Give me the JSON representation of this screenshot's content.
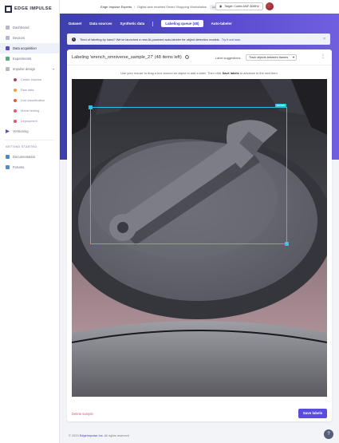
{
  "brand": {
    "name": "EDGE IMPULSE"
  },
  "sidebar": {
    "items": [
      {
        "label": "Dashboard",
        "color": "#8a8ea3"
      },
      {
        "label": "Devices",
        "color": "#8a8ea3"
      },
      {
        "label": "Data acquisition",
        "color": "#5a4bd0"
      },
      {
        "label": "Experiments",
        "color": "#4bb071"
      },
      {
        "label": "Impulse design",
        "color": "#8a8ea3"
      }
    ],
    "impulse_sub": [
      {
        "label": "Create impulse",
        "color": "#a3475b"
      },
      {
        "label": "Raw data",
        "color": "#e6a43a"
      },
      {
        "label": "Live classification",
        "color": "#e05a3a"
      },
      {
        "label": "Model testing",
        "color": "#e05a6b"
      },
      {
        "label": "Deployment",
        "color": "#e0556b"
      }
    ],
    "versioning": {
      "label": "Versioning",
      "color": "#5a4bd0"
    },
    "getting_started_head": "GETTING STARTED",
    "getting_started": [
      {
        "label": "Documentation",
        "color": "#4b8bd0"
      },
      {
        "label": "Forums",
        "color": "#4b8bd0"
      }
    ]
  },
  "topbar": {
    "org": "Edge Impulse Experts",
    "separator": "/",
    "project": "Digital-twin enabled Smart Shopping Workstation",
    "badge": "ENTERPRISE",
    "target": "Target: Cortex-M4F 80MHz"
  },
  "tabs": [
    "Dataset",
    "Data sources",
    "Synthetic data",
    "Labeling queue (48)",
    "Auto-labeler"
  ],
  "active_tab": 3,
  "alert": {
    "text": "Tired of labeling by hand? We've launched a new AI-powered auto-labeler for object detection models.",
    "link": "Try it out now."
  },
  "card": {
    "title": "Labeling 'wrench_omniverse_sample_27' (48 items left)",
    "suggest_label": "Label suggestions:",
    "suggest_value": "Track objects between frames",
    "instruction_pre": "Use your mouse to drag a box around an object to add a label. Then click",
    "instruction_bold": "Save labels",
    "instruction_post": "to advance to the next item."
  },
  "bbox": {
    "label": "wrench"
  },
  "actions": {
    "delete": "Delete sample",
    "save": "Save labels"
  },
  "footer": {
    "pre": "© 2024",
    "brand": "EdgeImpulse Inc.",
    "post": "All rights reserved"
  },
  "colors": {
    "accent": "#5b4ce0",
    "bbox": "#29c3de",
    "danger": "#e0556b"
  }
}
